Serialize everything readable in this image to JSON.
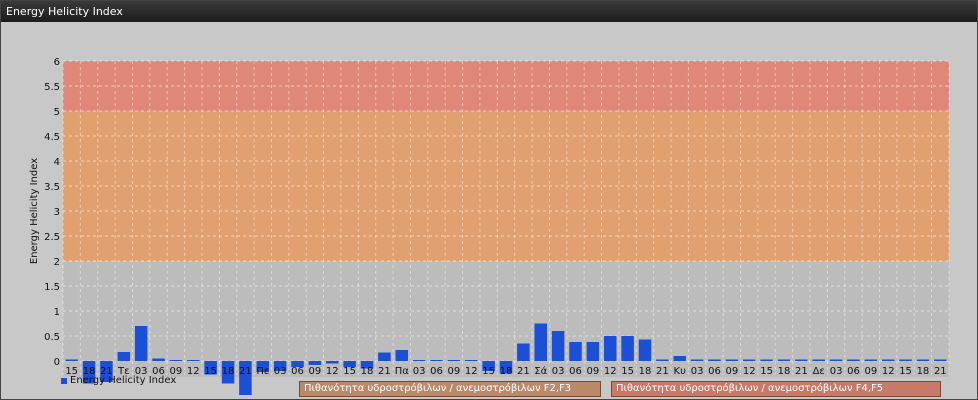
{
  "window": {
    "title": "Energy Helicity Index"
  },
  "legend": {
    "label": "Energy Helicity Index",
    "color": "#1a4fd6"
  },
  "bands": [
    {
      "label": "Πιθανότητα υδροστρόβιλων / ανεμοστρόβιλων F2,F3",
      "from": 2,
      "to": 5,
      "color": "#e0a070"
    },
    {
      "label": "Πιθανότητα υδροστρόβιλων / ανεμοστρόβιλων F4,F5",
      "from": 5,
      "to": 6,
      "color": "#e08878"
    }
  ],
  "chart_data": {
    "type": "bar",
    "ylabel": "Energy Helicity Index",
    "xlabel": "",
    "ylim": [
      0,
      6
    ],
    "yticks": [
      0,
      0.5,
      1,
      1.5,
      2,
      2.5,
      3,
      3.5,
      4,
      4.5,
      5,
      5.5,
      6
    ],
    "grid": true,
    "categories": [
      "15",
      "18",
      "21",
      "Τε",
      "03",
      "06",
      "09",
      "12",
      "15",
      "18",
      "21",
      "Πε",
      "03",
      "06",
      "09",
      "12",
      "15",
      "18",
      "21",
      "Πα",
      "03",
      "06",
      "09",
      "12",
      "15",
      "18",
      "21",
      "Σά",
      "03",
      "06",
      "09",
      "12",
      "15",
      "18",
      "21",
      "Κυ",
      "03",
      "06",
      "09",
      "12",
      "15",
      "18",
      "21",
      "Δε",
      "03",
      "06",
      "09",
      "12",
      "15",
      "18",
      "21"
    ],
    "series": [
      {
        "name": "Energy Helicity Index",
        "color": "#1a4fd6",
        "values": [
          0,
          -0.45,
          -0.42,
          0.18,
          0.7,
          0.05,
          0.02,
          0.02,
          -0.27,
          -0.45,
          -0.68,
          -0.22,
          -0.2,
          -0.12,
          -0.08,
          -0.05,
          -0.12,
          -0.15,
          0.17,
          0.22,
          0.02,
          0.02,
          0.02,
          0.02,
          -0.2,
          -0.25,
          0.35,
          0.75,
          0.6,
          0.38,
          0.38,
          0.5,
          0.5,
          0.43,
          0,
          0.1,
          0,
          0,
          0,
          0,
          0,
          0,
          0,
          0,
          0,
          0,
          0,
          0,
          0,
          0,
          0
        ]
      }
    ],
    "legend_position": "bottom-left"
  }
}
